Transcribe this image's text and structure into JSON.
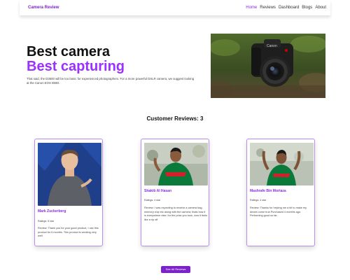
{
  "navbar": {
    "brand": "Camera Review",
    "links": [
      {
        "label": "Home",
        "active": true
      },
      {
        "label": "Reviews"
      },
      {
        "label": "Dashboard"
      },
      {
        "label": "Blogs"
      },
      {
        "label": "About"
      }
    ]
  },
  "hero": {
    "title_line1": "Best camera",
    "title_line2": "Best capturing",
    "description": "That said, the D3500 will be too basic for experienced photographers. For a more powerful DSLR camera, we suggest looking at the Canon EOS 850D.",
    "accent_color": "#9b30ff"
  },
  "reviews_section": {
    "title": "Customer Reviews: 3",
    "reviews": [
      {
        "name": "Mark Zuckerberg",
        "rating": "Ratings: 5 star",
        "text": "Review: Thank you for your good product, I use this product for 6 months. This product is working very well."
      },
      {
        "name": "Shakib Al Hasan",
        "rating": "Ratings: 4 star",
        "text": "Review: I was expecting to receive a camera bag, memory chip etc along with the camera; thats how it is everywhere else; for the price you took, now it feels like a rip off"
      },
      {
        "name": "Mashrafe Bin Mortaza",
        "rating": "Ratings: 4 star",
        "text": "Review: Thanks for helping me a bit to make my dream come true.Purchased 4 months ago. Performing good so far.."
      }
    ]
  },
  "see_all_label": "See All Reviews",
  "colors": {
    "brand": "#7b22c9",
    "card_border": "#b88cf0"
  }
}
